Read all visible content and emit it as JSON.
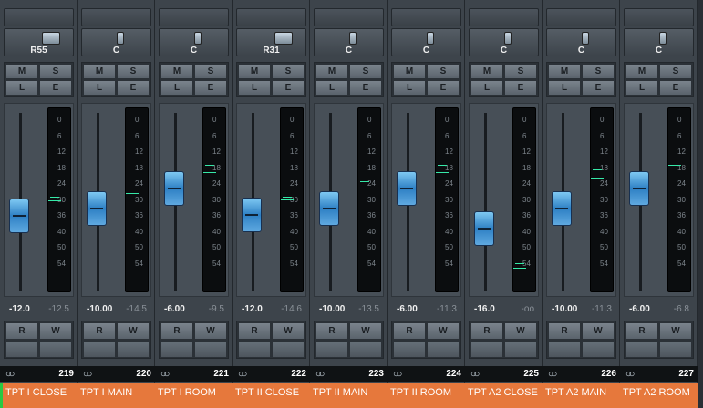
{
  "mixer": {
    "channels": [
      {
        "number": "219",
        "name": "TPT I CLOSE",
        "pan": "R55",
        "volume": "-12.0",
        "peak": "-12.5",
        "mute": "M",
        "solo": "S",
        "listen": "L",
        "edit": "E",
        "read": "R",
        "write": "W"
      },
      {
        "number": "220",
        "name": "TPT I MAIN",
        "pan": "C",
        "volume": "-10.00",
        "peak": "-14.5",
        "mute": "M",
        "solo": "S",
        "listen": "L",
        "edit": "E",
        "read": "R",
        "write": "W"
      },
      {
        "number": "221",
        "name": "TPT I ROOM",
        "pan": "C",
        "volume": "-6.00",
        "peak": "-9.5",
        "mute": "M",
        "solo": "S",
        "listen": "L",
        "edit": "E",
        "read": "R",
        "write": "W"
      },
      {
        "number": "222",
        "name": "TPT II CLOSE",
        "pan": "R31",
        "volume": "-12.0",
        "peak": "-14.6",
        "mute": "M",
        "solo": "S",
        "listen": "L",
        "edit": "E",
        "read": "R",
        "write": "W"
      },
      {
        "number": "223",
        "name": "TPT II MAIN",
        "pan": "C",
        "volume": "-10.00",
        "peak": "-13.5",
        "mute": "M",
        "solo": "S",
        "listen": "L",
        "edit": "E",
        "read": "R",
        "write": "W"
      },
      {
        "number": "224",
        "name": "TPT II ROOM",
        "pan": "C",
        "volume": "-6.00",
        "peak": "-11.3",
        "mute": "M",
        "solo": "S",
        "listen": "L",
        "edit": "E",
        "read": "R",
        "write": "W"
      },
      {
        "number": "225",
        "name": "TPT A2 CLOSE",
        "pan": "C",
        "volume": "-16.0",
        "peak": "-oo",
        "mute": "M",
        "solo": "S",
        "listen": "L",
        "edit": "E",
        "read": "R",
        "write": "W"
      },
      {
        "number": "226",
        "name": "TPT A2 MAIN",
        "pan": "C",
        "volume": "-10.00",
        "peak": "-11.3",
        "mute": "M",
        "solo": "S",
        "listen": "L",
        "edit": "E",
        "read": "R",
        "write": "W"
      },
      {
        "number": "227",
        "name": "TPT A2 ROOM",
        "pan": "C",
        "volume": "-6.00",
        "peak": "-6.8",
        "mute": "M",
        "solo": "S",
        "listen": "L",
        "edit": "E",
        "read": "R",
        "write": "W"
      }
    ],
    "meter_scale": [
      "0",
      "6",
      "12",
      "18",
      "24",
      "30",
      "36",
      "40",
      "50",
      "54"
    ],
    "icon": "stereo-link-icon",
    "accent_color": "#e6783c"
  }
}
